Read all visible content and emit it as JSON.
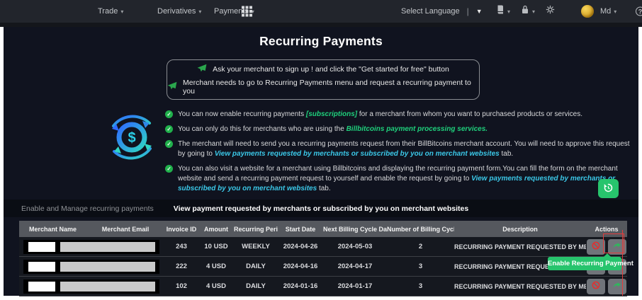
{
  "colors": {
    "accent_green": "#27c46d",
    "highlight_green": "#1fd07c",
    "link_cyan": "#3bc8e8",
    "danger_red": "#e03131",
    "nav_bg": "#22252c",
    "main_bg": "#10131f",
    "table_header_bg": "#55585e"
  },
  "nav": {
    "links": [
      {
        "label": "Trade"
      },
      {
        "label": "Derivatives"
      },
      {
        "label": "Payments"
      }
    ],
    "language_label": "Select Language",
    "user_label": "Md",
    "icons": [
      "apps-grid-icon",
      "book-icon",
      "lock-icon",
      "gear-icon",
      "avatar",
      "help-icon"
    ]
  },
  "page": {
    "title": "Recurring Payments"
  },
  "info_box": {
    "lines": [
      {
        "text": "Ask your merchant to sign up ! and click the \"Get started for free\" button"
      },
      {
        "text": "Merchant needs to go to Recurring Payments menu and request a recurring payment to you"
      }
    ]
  },
  "bullets": [
    {
      "pre": "You can now enable recurring payments ",
      "em": "[subscriptions]",
      "post": " for a merchant from whom you want to purchased products or services."
    },
    {
      "pre": "You can only do this for merchants who are using the ",
      "em": "Billbitcoins payment processing services.",
      "post": ""
    },
    {
      "pre": "The merchant will need to send you a recurring payments request from their BillBitcoins merchant account. You will need to approve this request by going to ",
      "em": "View payments requested by merchants or subscribed by you on merchant websites",
      "post": " tab."
    },
    {
      "pre": "You can also visit a website for a merchant using Billbitcoins and displaying the recurring payment form.You can fill the form on the merchant website and send a recurring payment request to yourself and enable the request by going to ",
      "em": "View payments requested by merchants or subscribed by you on merchant websites",
      "post": " tab."
    }
  ],
  "tabs": [
    {
      "label": "Enable and Manage recurring payments",
      "active": false
    },
    {
      "label": "View payment requested by merchants or subscribed by you on merchant websites",
      "active": true
    }
  ],
  "table": {
    "headers": [
      "Merchant Name",
      "Merchant Email",
      "Invoice ID",
      "Amount",
      "Recurring Period",
      "Start Date",
      "Next Billing Cycle Date",
      "Number of Billing Cycles",
      "Description",
      "Actions"
    ],
    "rows": [
      {
        "invoice_id": "243",
        "amount": "10 USD",
        "recurring_period": "WEEKLY",
        "start_date": "2024-04-26",
        "next_billing_cycle_date": "2024-05-03",
        "number_of_billing_cycles": "2",
        "description": "RECURRING PAYMENT REQUESTED BY MERCHANT"
      },
      {
        "invoice_id": "222",
        "amount": "4 USD",
        "recurring_period": "DAILY",
        "start_date": "2024-04-16",
        "next_billing_cycle_date": "2024-04-17",
        "number_of_billing_cycles": "3",
        "description": "RECURRING PAYMENT REQUESTED BY MERCHANT"
      },
      {
        "invoice_id": "102",
        "amount": "4 USD",
        "recurring_period": "DAILY",
        "start_date": "2024-01-16",
        "next_billing_cycle_date": "2024-01-17",
        "number_of_billing_cycles": "3",
        "description": "RECURRING PAYMENT REQUESTED BY MERCHANT"
      }
    ]
  },
  "tooltip": {
    "label": "Enable Recurring Payment"
  }
}
